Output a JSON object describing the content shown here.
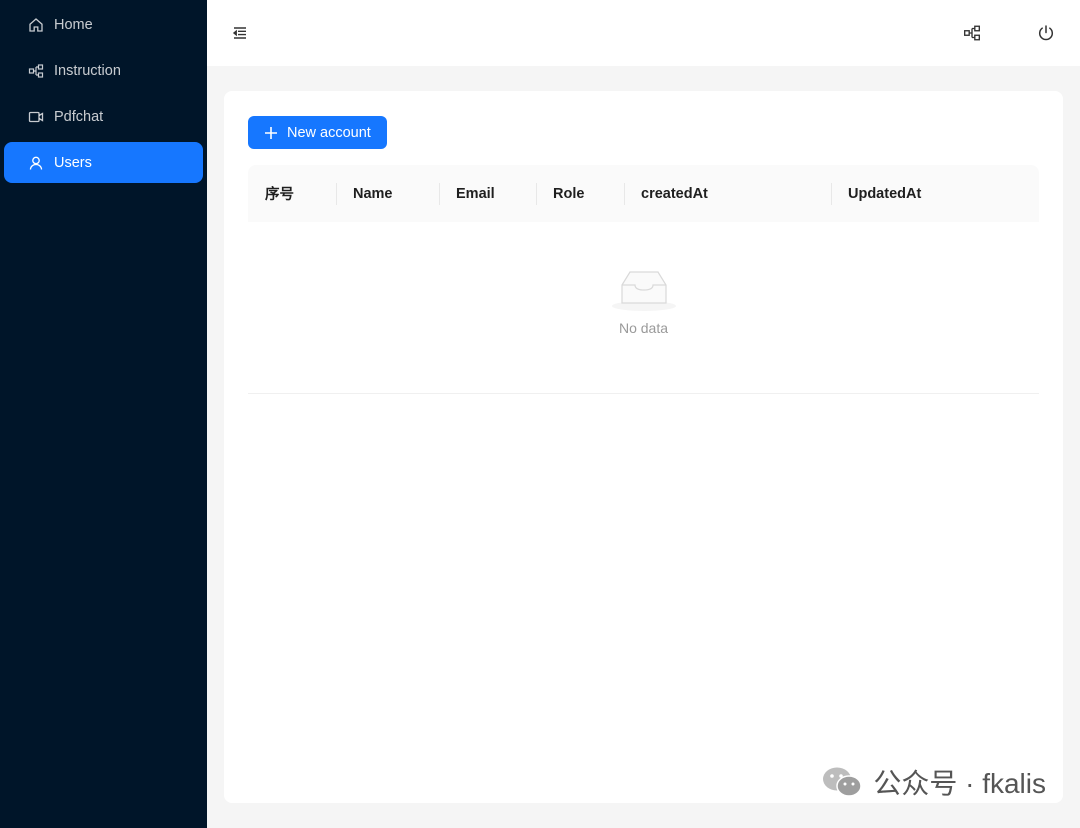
{
  "sidebar": {
    "items": [
      {
        "label": "Home",
        "icon": "home-icon"
      },
      {
        "label": "Instruction",
        "icon": "diagram-icon"
      },
      {
        "label": "Pdfchat",
        "icon": "video-icon"
      },
      {
        "label": "Users",
        "icon": "user-icon",
        "active": true
      }
    ]
  },
  "header": {
    "collapse_icon": "menu-fold-icon",
    "right_icons": [
      "diagram-icon",
      "power-icon"
    ]
  },
  "main": {
    "new_account_label": "New account",
    "table": {
      "columns": [
        "序号",
        "Name",
        "Email",
        "Role",
        "createdAt",
        "UpdatedAt"
      ],
      "rows": [],
      "empty_text": "No data"
    }
  },
  "watermark": {
    "text": "公众号 · fkalis"
  },
  "colors": {
    "sidebar_bg": "#001529",
    "accent": "#1677ff",
    "page_bg": "#f5f5f5"
  }
}
